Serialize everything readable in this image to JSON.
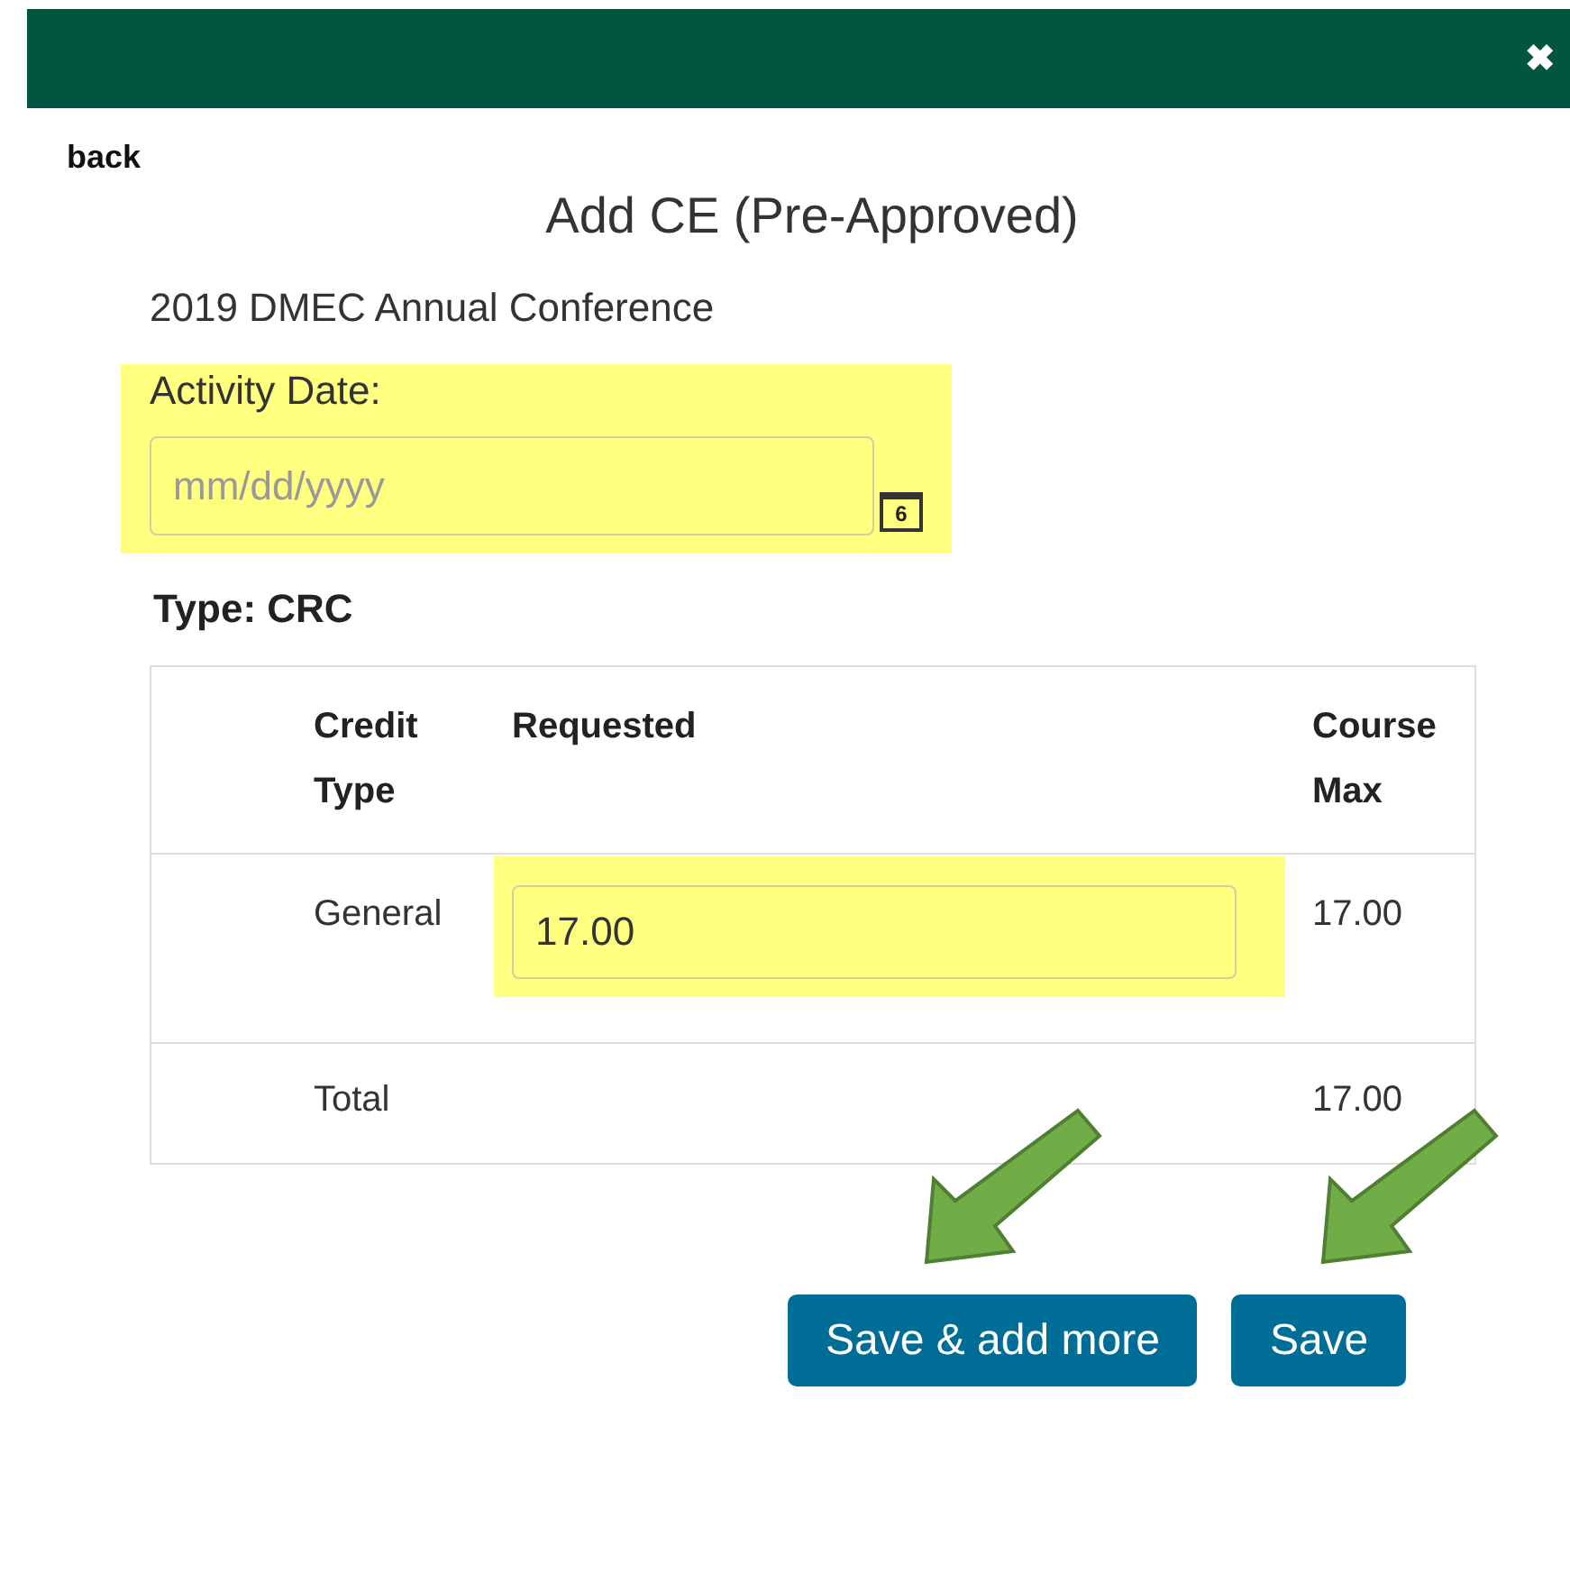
{
  "close_icon": "✖",
  "back": "back",
  "title": "Add CE (Pre-Approved)",
  "activity": "2019 DMEC Annual Conference",
  "date_field": {
    "label": "Activity Date:",
    "placeholder": "mm/dd/yyyy",
    "highlighted": true,
    "calendar_day": "6"
  },
  "type_label": "Type: CRC",
  "table": {
    "columns": [
      "Credit Type",
      "Requested",
      "Course Max"
    ],
    "rows": [
      {
        "kind": "input",
        "credit_type": "General",
        "requested": "17.00",
        "course_max": "17.00",
        "highlighted": true
      },
      {
        "kind": "total",
        "credit_type": "Total",
        "course_max": "17.00"
      }
    ]
  },
  "buttons": [
    {
      "label": "Save & add more",
      "arrow": true
    },
    {
      "label": "Save",
      "arrow": true
    }
  ]
}
